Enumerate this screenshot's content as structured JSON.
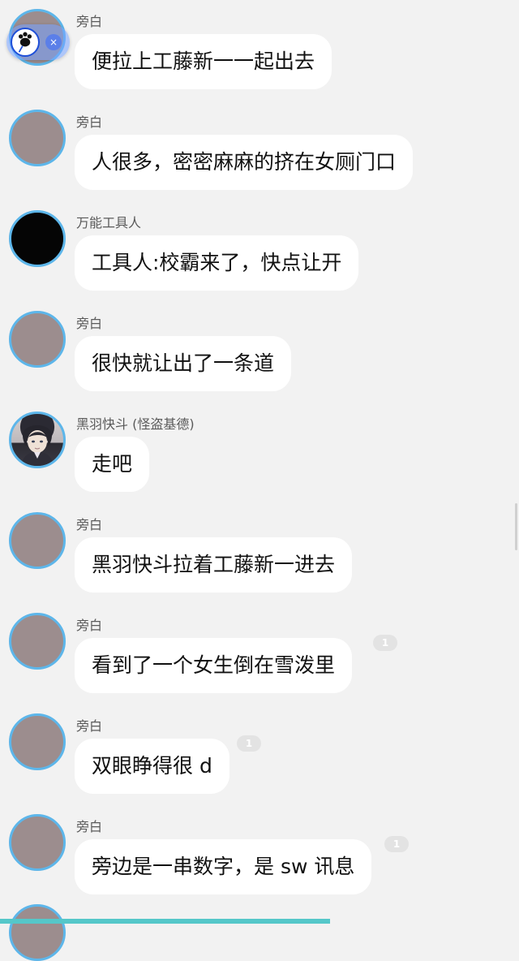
{
  "messages": [
    {
      "sender": "旁白",
      "text": "便拉上工藤新一一起出去",
      "avatar": "plain-avatar"
    },
    {
      "sender": "旁白",
      "text": "人很多，密密麻麻的挤在女厕门口",
      "avatar": "plain-avatar"
    },
    {
      "sender": "万能工具人",
      "text": "工具人:校霸来了，快点让开",
      "avatar": "black-avatar"
    },
    {
      "sender": "旁白",
      "text": "很快就让出了一条道",
      "avatar": "plain-avatar"
    },
    {
      "sender": "黑羽快斗 (怪盗基德)",
      "text": "走吧",
      "avatar": "character-avatar"
    },
    {
      "sender": "旁白",
      "text": "黑羽快斗拉着工藤新一进去",
      "avatar": "plain-avatar"
    },
    {
      "sender": "旁白",
      "text": "看到了一个女生倒在雪泼里",
      "avatar": "plain-avatar",
      "read_count": "1"
    },
    {
      "sender": "旁白",
      "text": "双眼睁得很 d",
      "avatar": "plain-avatar",
      "read_count": "1"
    },
    {
      "sender": "旁白",
      "text": "旁边是一串数字，是 sw 讯息",
      "avatar": "plain-avatar",
      "read_count": "1"
    }
  ],
  "floating_widget": {
    "paw_icon": "paw-icon",
    "close_icon": "close-icon",
    "close_symbol": "×"
  },
  "colors": {
    "background": "#f2f2f2",
    "bubble": "#ffffff",
    "avatar_ring": "#5db6ea",
    "avatar_fill": "#9c8d8e",
    "progress_bar": "#55c7c9"
  }
}
